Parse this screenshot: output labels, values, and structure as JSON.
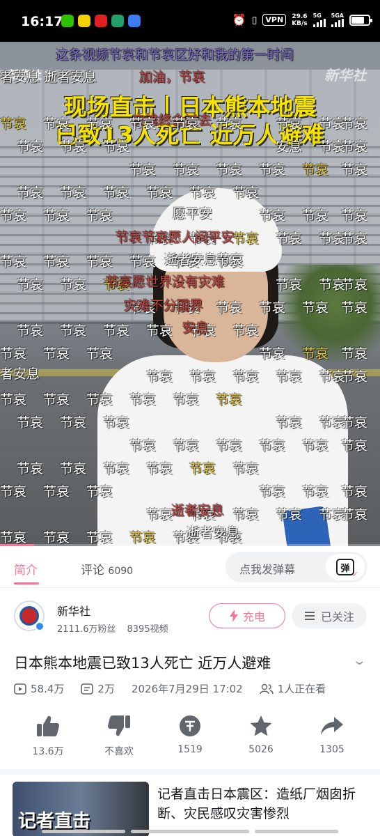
{
  "status_bar": {
    "time": "16:17",
    "vpn": "VPN",
    "speed_value": "29.6",
    "speed_unit": "KB/s",
    "net1": "5G",
    "net2": "5GA"
  },
  "video": {
    "watermark": "新华社",
    "headline_line1": "现场直击丨日本熊本地震",
    "headline_line2": "已致13人死亡 近万人避难",
    "progress_percent": 9,
    "danmaku": [
      "这条视频节哀和节哀区好和我的第一时间",
      "者安息 逝者安息",
      "加油，节哀",
      "节哀",
      "灾难终会过去",
      "节哀",
      "节哀",
      "节哀",
      "节哀",
      "节哀",
      "安息",
      "节哀",
      "节哀",
      "节哀",
      "节哀",
      "节哀",
      "节哀",
      "节哀",
      "节哀",
      "节哀",
      "节哀",
      "节哀",
      "节哀",
      "节哀",
      "节哀",
      "节哀",
      "节哀",
      "节哀",
      "节哀",
      "节哀",
      "节哀",
      "节哀",
      "节哀",
      "节哀",
      "节哀",
      "节哀",
      "愿平安",
      "节哀",
      "节哀",
      "节哀",
      "节哀",
      "节哀",
      "节哀",
      "节哀",
      "节哀节哀愿人间平安",
      "节哀",
      "节哀",
      "节哀",
      "逝者安息节哀",
      "节哀",
      "节哀",
      "节哀",
      "节哀",
      "节哀",
      "节哀",
      "节哀",
      "节哀愿世界没有灾难",
      "节哀",
      "节哀",
      "节哀",
      "节哀",
      "节哀",
      "灾难不分国界",
      "节哀",
      "节哀",
      "节哀",
      "节哀",
      "节哀",
      "节哀",
      "安息",
      "节哀",
      "节哀",
      "节哀",
      "节哀",
      "节哀",
      "节哀",
      "节哀",
      "节哀",
      "节哀",
      "节哀",
      "节哀",
      "节哀",
      "者安息",
      "节哀",
      "节哀",
      "节哀",
      "节哀",
      "节哀",
      "节哀",
      "节哀",
      "节哀",
      "节哀",
      "节哀",
      "节哀",
      "节哀",
      "节哀",
      "节哀",
      "节哀",
      "节哀",
      "节哀",
      "节哀",
      "节哀",
      "节哀",
      "节哀",
      "节哀",
      "节哀",
      "节哀",
      "节哀",
      "节哀",
      "节哀",
      "节哀",
      "节哀",
      "节哀",
      "节哀",
      "节哀",
      "节哀",
      "节哀",
      "节哀",
      "节哀",
      "节哀",
      "节哀",
      "节哀",
      "节哀",
      "节哀",
      "逝者安息",
      "节哀",
      "节哀",
      "逝者安息",
      "节哀",
      "节哀"
    ]
  },
  "tabs": {
    "intro": "简介",
    "comments": "评论",
    "comments_count": "6090",
    "danmu_placeholder": "点我发弹幕",
    "danmu_button": "弹"
  },
  "uploader": {
    "name": "新华社",
    "fans": "2111.6万粉丝",
    "videos": "8395视频",
    "charge": "充电",
    "follow": "已关注"
  },
  "video_info": {
    "title": "日本熊本地震已致13人死亡 近万人避难",
    "plays": "58.4万",
    "danmaku_count": "2万",
    "date": "2026年7月29日 17:02",
    "watching": "1人正在看"
  },
  "actions": {
    "like": "13.6万",
    "dislike": "不喜欢",
    "coin": "1519",
    "favorite": "5026",
    "share": "1305"
  },
  "recommend": {
    "thumb_text": "记者直击",
    "title": "记者直击日本震区：造纸厂烟囱折断、灾民感叹灾害惨烈"
  },
  "colors": {
    "accent": "#fb7299",
    "headline": "#f7e300"
  }
}
